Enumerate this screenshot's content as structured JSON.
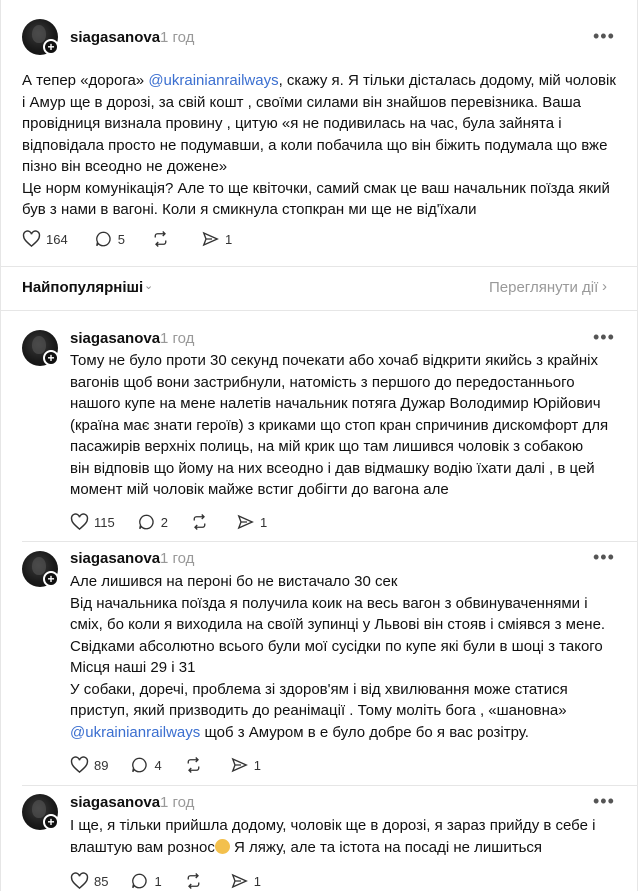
{
  "main_post": {
    "username": "siagasanova",
    "time": "1 год",
    "text_before_mention": "А тепер «дорога» ",
    "mention": "@ukrainianrailways",
    "text_after_mention": ", скажу я. Я тільки дісталась додому, мій чоловік\nі Амур ще в дорозі, за свій кошт , своїми силами він знайшов перевізника. Ваша\nпровідниця визнала провину , цитую «я не подивилась на час, була зайнята і\nвідповідала просто не подумавши, а коли побачила що він біжить подумала що вже\nпізно він всеодно не дожене»\nЦе норм комунікація? Але то ще квіточки, самий смак це ваш начальник поїзда який\nбув з нами в вагоні. Коли я смикнула стопкран ми ще не від'їхали",
    "likes": "164",
    "comments": "5",
    "shares": "1"
  },
  "sort_bar": {
    "label": "Найпопулярніші",
    "view_activity": "Переглянути дії"
  },
  "replies": [
    {
      "username": "siagasanova",
      "time": "1 год",
      "text": "Тому не було проти 30 секунд почекати або хочаб відкрити якийсь з крайніх\nвагонів щоб вони застрибнули, натомість з першого до передостаннього\nнашого купе на мене налетів начальник потяга Дужар Володимир Юрійович\n(країна має знати героїв) з криками що стоп кран спричинив дискомфорт для\nпасажирів верхніх полиць, на мій крик що там лишився чоловік з собакою\nвін відповів що йому на них всеодно і дав відмашку водію їхати далі , в цей\nмомент мій чоловік майже встиг добігти до вагона але",
      "likes": "115",
      "comments": "2",
      "shares": "1"
    },
    {
      "username": "siagasanova",
      "time": "1 год",
      "text_before_mention": "Але лишився на пероні бо не вистачало 30 сек\nВід начальника поїзда я получила коик на весь вагон з обвинуваченнями і\nсміх, бо коли я виходила на своїй зупинці у Львові він стояв і сміявся з мене.\nСвідками абсолютно всього були мої сусідки по купе які були в шоці з такого\nМісця наші 29 і 31\nУ собаки, доречі, проблема зі здоров'ям і від хвилювання може статися\nприступ, який призводить до реанімації . Тому моліть бога , «шановна»\n",
      "mention": "@ukrainianrailways",
      "text_after_mention": " щоб з Амуром в е було добре бо я вас розітру.",
      "likes": "89",
      "comments": "4",
      "shares": "1"
    },
    {
      "username": "siagasanova",
      "time": "1 год",
      "text_before_emoji": "І ще, я тільки прийшла додому, чоловік ще в дорозі, я зараз прийду в себе і\nвлаштую вам рознос",
      "text_after_emoji": " Я ляжу, але та істота на посаді не лишиться",
      "likes": "85",
      "comments": "1",
      "shares": "1"
    }
  ],
  "icons": {
    "like": "heart-icon",
    "comment": "comment-icon",
    "repost": "repost-icon",
    "share": "share-icon",
    "more": "more-icon",
    "follow": "plus-icon",
    "sort": "chevron-down-icon",
    "view": "chevron-right-icon"
  }
}
